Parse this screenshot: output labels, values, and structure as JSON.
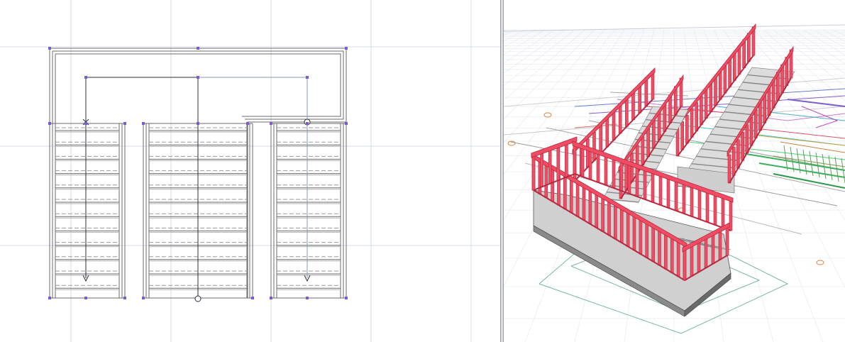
{
  "app": {
    "views": [
      "plan-view",
      "3d-view"
    ]
  },
  "plan": {
    "flights": [
      {
        "name": "left-flight",
        "direction": "down",
        "steps": 12
      },
      {
        "name": "center-flight",
        "direction": "up",
        "steps": 12
      },
      {
        "name": "right-flight",
        "direction": "down",
        "steps": 12
      }
    ]
  },
  "colors": {
    "background": "#ffffff",
    "plan_line": "#6b6b6b",
    "plan_walkline": "#2c2c3c",
    "plan_grid": "#d7dbe8",
    "selection_node": "#7a5ccc",
    "railing": "#f04d64",
    "railing_dark": "#b8293d",
    "stair_gray": "#b3b3b3",
    "divider": "#d9dce2"
  }
}
